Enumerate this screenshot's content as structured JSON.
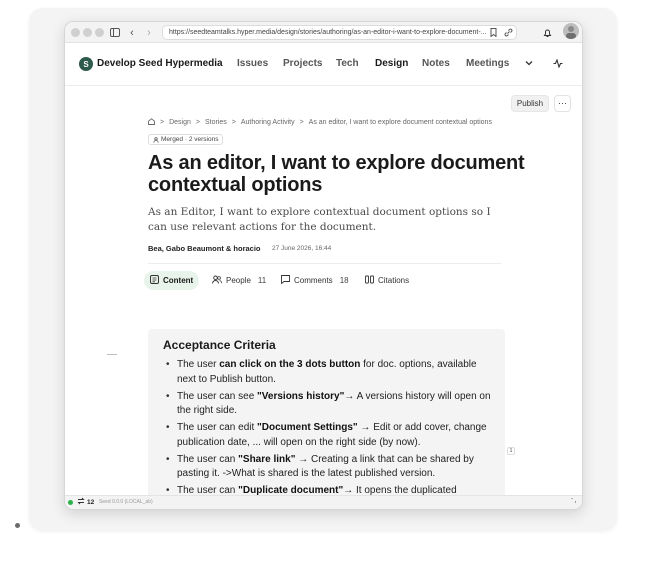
{
  "browser": {
    "url": "https://seedteamtalks.hyper.media/design/stories/authoring/as-an-editor-i-want-to-explore-document-..."
  },
  "site": {
    "title": "Develop Seed Hypermedia",
    "logo_letter": "S",
    "nav": [
      {
        "label": "Issues",
        "active": false
      },
      {
        "label": "Projects",
        "active": false
      },
      {
        "label": "Tech",
        "active": false
      },
      {
        "label": "Design",
        "active": true
      },
      {
        "label": "Notes",
        "active": false
      },
      {
        "label": "Meetings",
        "active": false
      }
    ]
  },
  "toolbar": {
    "publish_label": "Publish",
    "more_label": "···"
  },
  "breadcrumb": {
    "sep": ">",
    "items": [
      "Design",
      "Stories",
      "Authoring Activity",
      "As an editor, I want to explore document contextual options"
    ]
  },
  "document": {
    "badge": "Merged · 2 versions",
    "title": "As an editor, I want to explore document contextual options",
    "summary": "As an Editor, I want to explore contextual document options so I can use relevant actions for the document.",
    "authors": "Bea, Gabo Beaumont & horacio",
    "date": "27 June 2026, 16:44"
  },
  "tabs": [
    {
      "label": "Content",
      "count": "",
      "icon": "content-icon",
      "active": true
    },
    {
      "label": "People",
      "count": "11",
      "icon": "people-icon",
      "active": false
    },
    {
      "label": "Comments",
      "count": "18",
      "icon": "comment-icon",
      "active": false
    },
    {
      "label": "Citations",
      "count": "",
      "icon": "citation-icon",
      "active": false
    }
  ],
  "content": {
    "heading": "Acceptance Criteria",
    "criteria": [
      {
        "pre": "The user ",
        "bold": "can click on the 3 dots button",
        "post": " for doc. options, available next to Publish button."
      },
      {
        "pre": "The user can see ",
        "bold": "\"Versions history\"",
        "post": "→ A versions history will open on the right side."
      },
      {
        "pre": "The user can edit ",
        "bold": "\"Document Settings\"",
        "post": " → Edit or add cover, change publication date, ... will open on the right side (by now)."
      },
      {
        "pre": "The user can ",
        "bold": "\"Share link\"",
        "post": " → Creating a link that can be shared by pasting it. ->What is shared is the latest published version."
      },
      {
        "pre": "The user can ",
        "bold": "\"Duplicate document\"",
        "post": "→ It opens the duplicated document"
      }
    ],
    "footnote": "1"
  },
  "status": {
    "count": "12",
    "version": "Seed 0.0.0 (LOCAL_ab)"
  },
  "colors": {
    "logo": "#2e5a4c",
    "active_tab_bg": "#e8f3ec",
    "online": "#2bb24c"
  }
}
